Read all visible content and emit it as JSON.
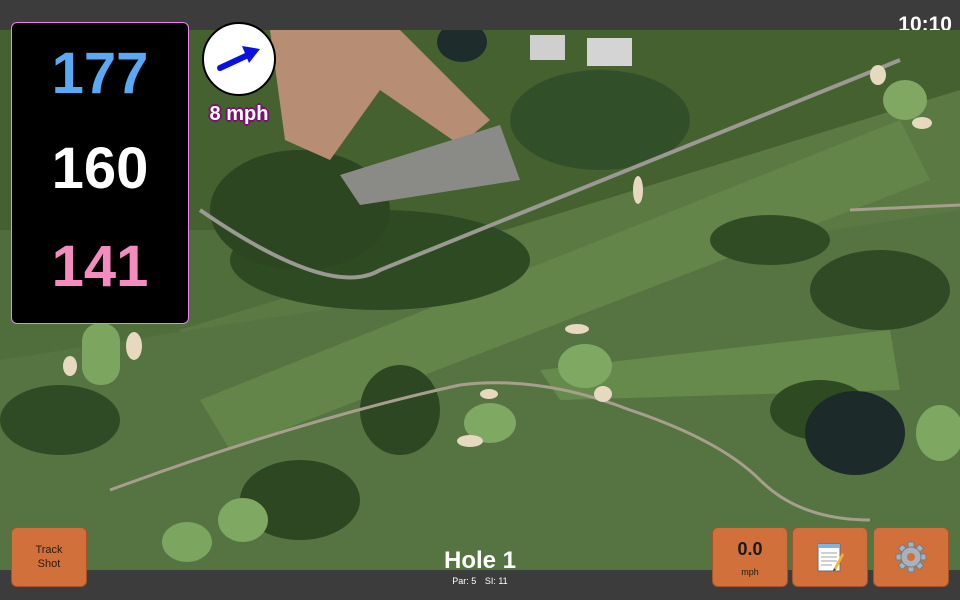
{
  "status": {
    "time": "10:10"
  },
  "distances": {
    "back": "177",
    "middle": "160",
    "front": "141"
  },
  "wind": {
    "speed_label": "8 mph",
    "icon": "wind-arrow-icon"
  },
  "hole": {
    "title": "Hole 1",
    "par": "Par: 5",
    "stroke_index": "SI: 11"
  },
  "buttons": {
    "track_shot_line1": "Track",
    "track_shot_line2": "Shot",
    "speed_value": "0.0",
    "speed_unit": "mph",
    "notes_icon": "notepad-icon",
    "settings_icon": "gear-icon"
  },
  "colors": {
    "back_distance": "#5aa9f5",
    "middle_distance": "#ffffff",
    "front_distance": "#f48cc0",
    "button": "#d2703c",
    "panel_border": "#ee82ee"
  }
}
